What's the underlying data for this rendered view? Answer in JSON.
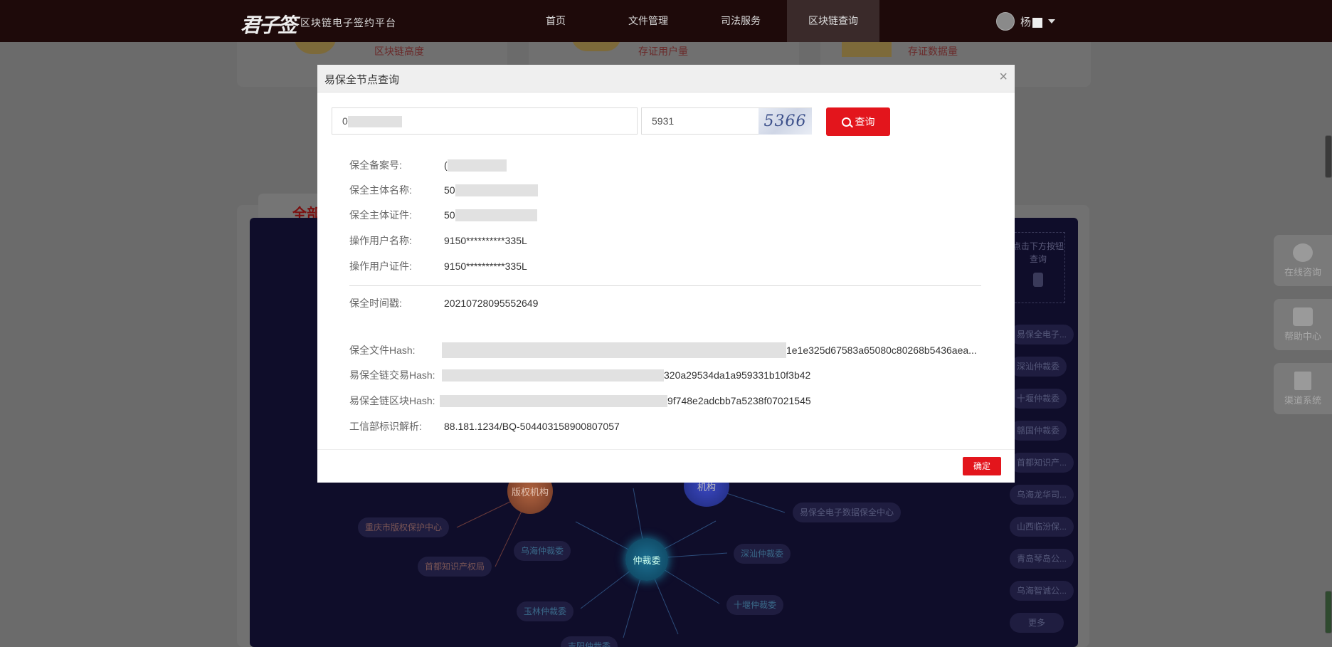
{
  "nav": {
    "logo": "君子签",
    "logo_sub": "区块链电子签约平台",
    "items": [
      "首页",
      "文件管理",
      "司法服务",
      "区块链查询"
    ],
    "user_name": "杨"
  },
  "stats": [
    "区块链高度",
    "存证用户量",
    "存证数据量"
  ],
  "section_tab": "全部",
  "graph": {
    "hint": "点击下方按钮查询",
    "side_items": [
      "易保全电子...",
      "深汕仲裁委",
      "十堰仲裁委",
      "赣国仲裁委",
      "首都知识产...",
      "乌海龙华司...",
      "山西临汾保...",
      "青岛琴岛公...",
      "乌海智诚公..."
    ],
    "more": "更多",
    "nodes": {
      "copyright": "版权机构",
      "institution": "机构",
      "arbitration": "仲裁委"
    },
    "leaf_labels": [
      "重庆市版权保护中心",
      "首都知识产权局",
      "乌海仲裁委",
      "易保全电子数据保全中心",
      "深汕仲裁委",
      "十堰仲裁委",
      "玉林仲裁委",
      "吉阳仲裁委"
    ]
  },
  "float_buttons": [
    "在线咨询",
    "帮助中心",
    "渠道系统"
  ],
  "modal": {
    "title": "易保全节点查询",
    "close": "×",
    "query_value": "0",
    "captcha_input": "5931",
    "captcha_text": "5366",
    "search_label": "查询",
    "fields": [
      {
        "label": "保全备案号:",
        "value": "("
      },
      {
        "label": "保全主体名称:",
        "value": "50"
      },
      {
        "label": "保全主体证件:",
        "value": "50"
      },
      {
        "label": "操作用户名称:",
        "value": "9150**********335L"
      },
      {
        "label": "操作用户证件:",
        "value": "9150**********335L"
      }
    ],
    "timestamp": {
      "label": "保全时间戳:",
      "value": "20210728095552649"
    },
    "hashes": [
      {
        "label": "保全文件Hash:",
        "value": "1e1e325d67583a65080c80268b5436aea..."
      },
      {
        "label": "易保全链交易Hash:",
        "value": "320a29534da1a959331b10f3b42"
      },
      {
        "label": "易保全链区块Hash:",
        "value": "9f748e2adcbb7a5238f07021545"
      }
    ],
    "miit": {
      "label": "工信部标识解析:",
      "value": "88.181.1234/BQ-504403158900807057"
    },
    "ok_label": "确定"
  }
}
